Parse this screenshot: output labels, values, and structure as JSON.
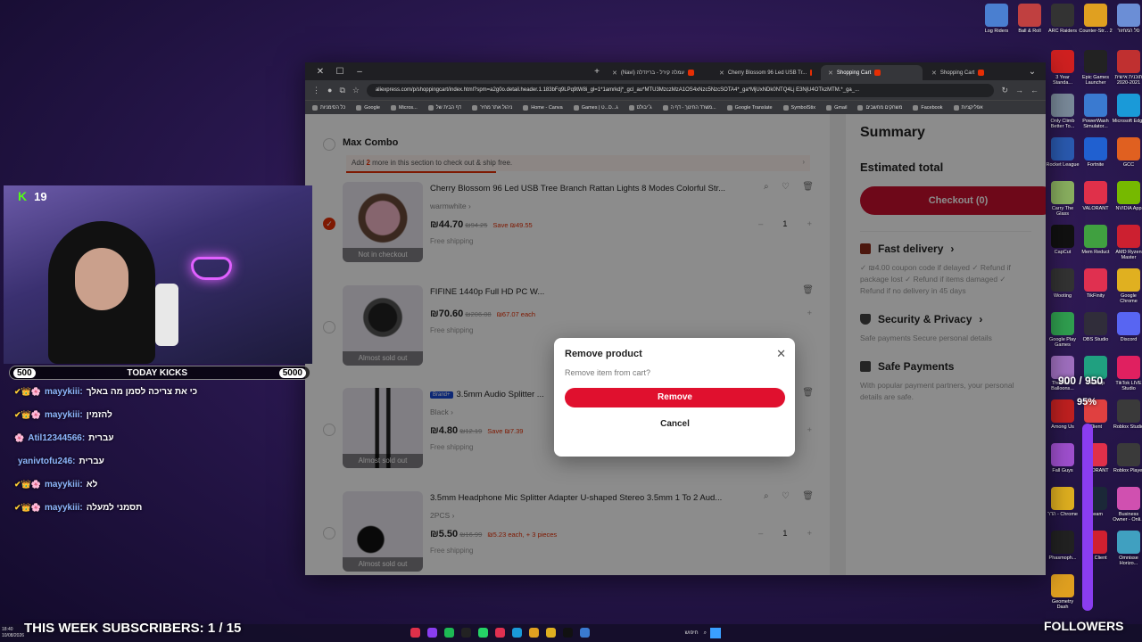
{
  "browser": {
    "tabs": [
      {
        "label": "(Navi) עמלה קירל - בריזדלה"
      },
      {
        "label": "Cherry Blossom 96 Led USB Tr..."
      },
      {
        "label": "Shopping Cart"
      },
      {
        "label": "Shopping Cart"
      }
    ],
    "url": "aliexpress.com/p/shoppingcart/index.html?spm=a2g0o.detail.header.1.183bFq9LPq9tW8i_gl=1*1amrkdj*_gcl_au*MTU3MzczMzA1OS4xNzc5NzcSOTA4*_ga*MjUxNDk0NTQ4Lj E3NjU4OTkzMTM.*_ga_...",
    "bookmarks": [
      "כל הסימניות",
      "Google",
      "Micros...",
      "דף הבית של",
      "ניהול אתר מחיר",
      "Home - Canva",
      "Games | ג...ס...ט",
      "ג׳יבולס",
      "משרד החינוך - דף ה...",
      "Google Translate",
      "SymbolStix",
      "Gmail",
      "משחקים מחשבים",
      "Facebook",
      "אפליקציות"
    ]
  },
  "cart": {
    "group_title": "Max Combo",
    "notice_prefix": "Add ",
    "notice_count": "2",
    "notice_suffix": " more in this section to check out & ship free.",
    "items": [
      {
        "title": "Cherry Blossom 96 Led USB Tree Branch Rattan Lights 8 Modes Colorful Str...",
        "variant": "warmwhite",
        "price": "₪44.70",
        "old_price": "₪94.25",
        "save": "Save ₪49.55",
        "shipping": "Free shipping",
        "qty": "1",
        "state": "Not in checkout"
      },
      {
        "title": "FIFINE 1440p Full HD PC W...",
        "variant": "",
        "price": "₪70.60",
        "old_price": "₪206.08",
        "save": "₪67.07 each",
        "shipping": "Free shipping",
        "qty": "",
        "state": "Almost sold out"
      },
      {
        "brand": "Brand+",
        "title": "3.5mm Audio Splitter ...",
        "variant": "Black",
        "price": "₪4.80",
        "old_price": "₪12.19",
        "save": "Save ₪7.39",
        "shipping": "Free shipping",
        "qty": "1",
        "state": "Almost sold out"
      },
      {
        "title": "3.5mm Headphone Mic Splitter Adapter U-shaped Stereo 3.5mm 1 To 2 Aud...",
        "variant": "2PCS",
        "price": "₪5.50",
        "old_price": "₪16.99",
        "save": "₪5.23 each, + 3 pieces",
        "shipping": "Free shipping",
        "qty": "1",
        "state": "Almost sold out"
      }
    ]
  },
  "summary": {
    "title": "Summary",
    "estimated_total": "Estimated total",
    "checkout": "Checkout (0)",
    "fast_delivery": "Fast delivery",
    "fast_delivery_desc": "✓ ₪4.00 coupon code if delayed ✓ Refund if package lost ✓ Refund if items damaged ✓ Refund if no delivery in 45 days",
    "security": "Security & Privacy",
    "security_desc": "Safe payments Secure personal details",
    "safe_payments": "Safe Payments",
    "safe_payments_desc": "With popular payment partners, your personal details are safe."
  },
  "modal": {
    "title": "Remove product",
    "subtitle": "Remove item from cart?",
    "remove": "Remove",
    "cancel": "Cancel"
  },
  "stream": {
    "viewers": "19",
    "kick_left": "500",
    "kick_label": "TODAY KICKS",
    "kick_right": "5000",
    "chat": [
      {
        "user": "mayykiii:",
        "text": "כי את צריכה לסמן מה באלך",
        "badges": "✔👑🌸"
      },
      {
        "user": "mayykiii:",
        "text": "להזמין",
        "badges": "✔👑🌸"
      },
      {
        "user": "Atil12344566:",
        "text": "עברית",
        "badges": "🌸"
      },
      {
        "user": "yanivtofu246:",
        "text": "עברית",
        "badges": ""
      },
      {
        "user": "mayykiii:",
        "text": "לא",
        "badges": "✔👑🌸"
      },
      {
        "user": "mayykiii:",
        "text": "תסמני למעלה",
        "badges": "✔👑🌸"
      }
    ],
    "subscribers": "THIS WEEK SUBSCRIBERS: 1 / 15",
    "followers": "FOLLOWERS",
    "goal": "900 / 950",
    "goal_pct": "95%"
  },
  "desktop_icons": [
    {
      "label": "Log Riders",
      "color": "#4a7fd0"
    },
    {
      "label": "Ball & Roll",
      "color": "#c04040"
    },
    {
      "label": "ARC Raiders",
      "color": "#333333"
    },
    {
      "label": "Counter-Str... 2",
      "color": "#e0a020"
    },
    {
      "label": "סל המחזור",
      "color": "#6b8ed6"
    },
    {
      "label": "3 Year Standa...",
      "color": "#d02020"
    },
    {
      "label": "Epic Games Launcher",
      "color": "#222222"
    },
    {
      "label": "תוכנית אישית 2020-2021",
      "color": "#c03030"
    },
    {
      "label": "Only Climb Better To...",
      "color": "#7a8a9a"
    },
    {
      "label": "PowerWash Simulator...",
      "color": "#3a7ad0"
    },
    {
      "label": "Microsoft Edge",
      "color": "#1a9ad8"
    },
    {
      "label": "Rocket League",
      "color": "#2a5ab0"
    },
    {
      "label": "Fortnite",
      "color": "#2060d0"
    },
    {
      "label": "GCC",
      "color": "#e06020"
    },
    {
      "label": "Carry The Glass",
      "color": "#8ab060"
    },
    {
      "label": "VALORANT",
      "color": "#e0304a"
    },
    {
      "label": "NVIDIA App",
      "color": "#76b900"
    },
    {
      "label": "CapCut",
      "color": "#111111"
    },
    {
      "label": "Mem Reduct",
      "color": "#40a040"
    },
    {
      "label": "AMD Ryzen Master",
      "color": "#cc2030"
    },
    {
      "label": "Wooting",
      "color": "#333333"
    },
    {
      "label": "TikFinity",
      "color": "#e03050"
    },
    {
      "label": "Google Chrome",
      "color": "#e0b020"
    },
    {
      "label": "Google Play Games",
      "color": "#30a050"
    },
    {
      "label": "OBS Studio",
      "color": "#302d3a"
    },
    {
      "label": "Discord",
      "color": "#5865f2"
    },
    {
      "label": "Thomas... Balloons...",
      "color": "#a070c0"
    },
    {
      "label": "Desktop",
      "color": "#20a080"
    },
    {
      "label": "TikTok LIVE Studio",
      "color": "#e02060"
    },
    {
      "label": "Among Us",
      "color": "#c02020"
    },
    {
      "label": "Client",
      "color": "#e04040"
    },
    {
      "label": "Roblox Studio",
      "color": "#3a3a3a"
    },
    {
      "label": "Fall Guys",
      "color": "#a050d0"
    },
    {
      "label": "VALORANT",
      "color": "#e0304a"
    },
    {
      "label": "Roblox Player",
      "color": "#3a3a3a"
    },
    {
      "label": "הדר - Chrome",
      "color": "#e0b020"
    },
    {
      "label": "Steam",
      "color": "#1b2838"
    },
    {
      "label": "Business Owner - Onli...",
      "color": "#d050b0"
    },
    {
      "label": "Phasmoph...",
      "color": "#222222"
    },
    {
      "label": "Riot Client",
      "color": "#d02030"
    },
    {
      "label": "Omnisse Horizo...",
      "color": "#40a0c0"
    },
    {
      "label": "Geometry Dash",
      "color": "#e0a020"
    }
  ],
  "taskbar": {
    "time": "18:40",
    "date": "10/08/2026",
    "search": "חיפוש"
  }
}
